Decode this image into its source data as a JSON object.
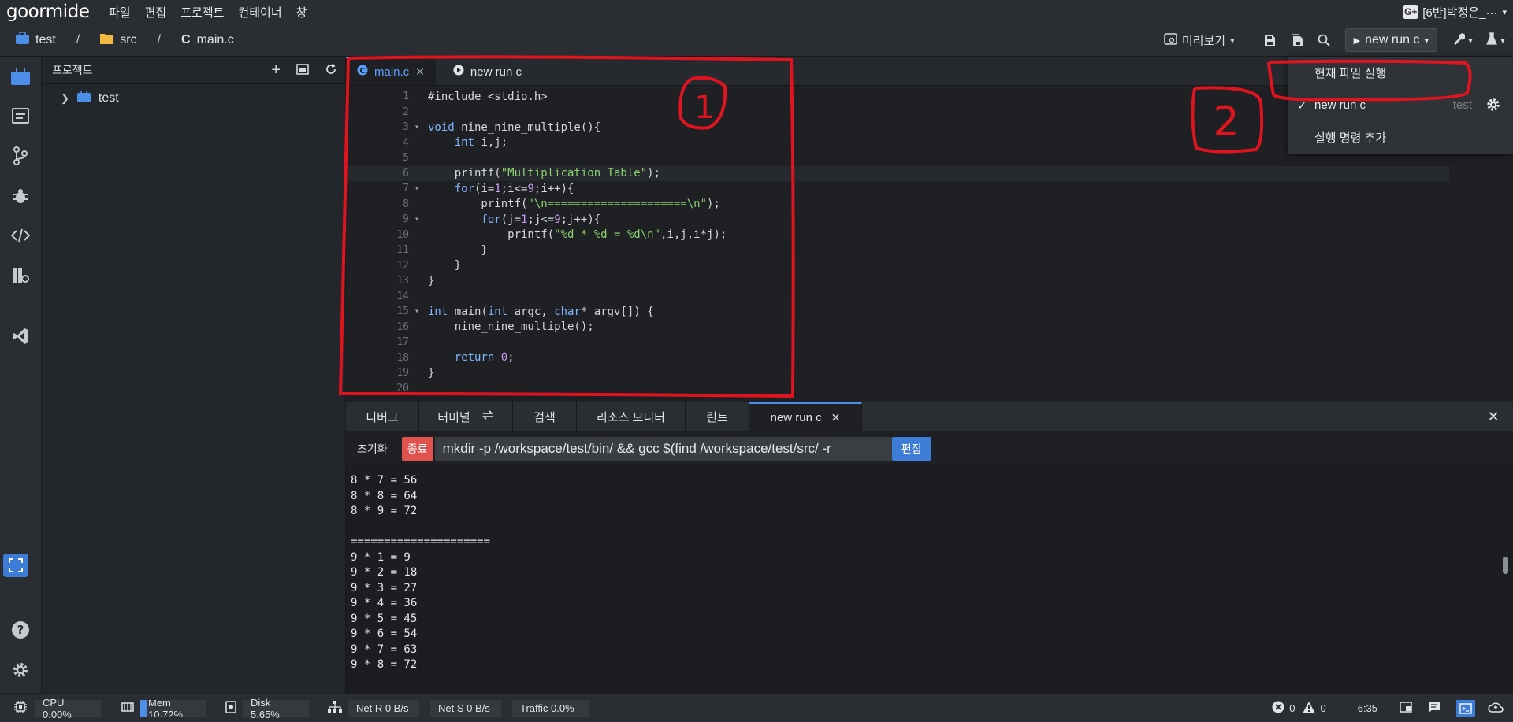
{
  "app": {
    "logo": "goormide"
  },
  "menu": [
    "파일",
    "편집",
    "프로젝트",
    "컨테이너",
    "창"
  ],
  "user": {
    "name": "[6반]박정은_···",
    "badge": "G+"
  },
  "breadcrumb": [
    "test",
    "src",
    "main.c"
  ],
  "toolbar": {
    "preview_label": "미리보기",
    "run_label": "new run c"
  },
  "sidebar": {
    "title": "프로젝트",
    "tree": [
      {
        "label": "test"
      }
    ]
  },
  "editor": {
    "tabs": [
      {
        "label": "main.c"
      },
      {
        "label": "new run c"
      }
    ],
    "highlight_line": 6,
    "lines": [
      "#include <stdio.h>",
      "",
      "void nine_nine_multiple(){",
      "    int i,j;",
      "",
      "    printf(\"Multiplication Table\");",
      "    for(i=1;i<=9;i++){",
      "        printf(\"\\n=====================\\n\");",
      "        for(j=1;j<=9;j++){",
      "            printf(\"%d * %d = %d\\n\",i,j,i*j);",
      "        }",
      "    }",
      "}",
      "",
      "int main(int argc, char* argv[]) {",
      "    nine_nine_multiple();",
      "",
      "    return 0;",
      "}",
      ""
    ],
    "folds": [
      3,
      7,
      9,
      15
    ]
  },
  "panel": {
    "tabs": [
      {
        "label": "디버그"
      },
      {
        "label": "터미널"
      },
      {
        "label": "검색"
      },
      {
        "label": "리소스 모니터"
      },
      {
        "label": "린트"
      },
      {
        "label": "new run c"
      }
    ],
    "reset_label": "초기화",
    "stop_label": "종료",
    "command": "mkdir -p /workspace/test/bin/ && gcc $(find /workspace/test/src/ -r",
    "edit_label": "편집",
    "output": [
      "8 * 7 = 56",
      "8 * 8 = 64",
      "8 * 9 = 72",
      "",
      "=====================",
      "9 * 1 = 9",
      "9 * 2 = 18",
      "9 * 3 = 27",
      "9 * 4 = 36",
      "9 * 5 = 45",
      "9 * 6 = 54",
      "9 * 7 = 63",
      "9 * 8 = 72"
    ]
  },
  "dropdown": {
    "items": [
      {
        "label": "현재 파일 실행"
      },
      {
        "label": "new run c",
        "tag": "test",
        "checked": true
      },
      {
        "label": "실행 명령 추가"
      }
    ]
  },
  "status": {
    "cpu": "CPU 0.00%",
    "mem": "Mem 10.72%",
    "mem_fraction": 0.1072,
    "disk": "Disk 5.65%",
    "net_r": "Net R 0 B/s",
    "net_s": "Net S 0 B/s",
    "traffic": "Traffic 0.0%",
    "errors": "0",
    "warnings": "0",
    "time": "6:35"
  },
  "annotations": {
    "one": "1",
    "two": "2"
  },
  "colors": {
    "accent": "#4c8fe8",
    "stop": "#e0524d",
    "annotation": "#e0141e"
  }
}
